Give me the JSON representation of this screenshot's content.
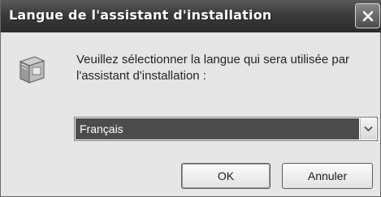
{
  "dialog": {
    "title": "Langue de l'assistant d'installation",
    "close_icon": "close-icon",
    "app_icon": "installer-box-icon",
    "message": "Veuillez sélectionner la langue qui sera utilisée par l'assistant d'installation :",
    "language": {
      "selected": "Français",
      "arrow_icon": "chevron-down-icon"
    },
    "buttons": {
      "ok": "OK",
      "cancel": "Annuler"
    }
  }
}
